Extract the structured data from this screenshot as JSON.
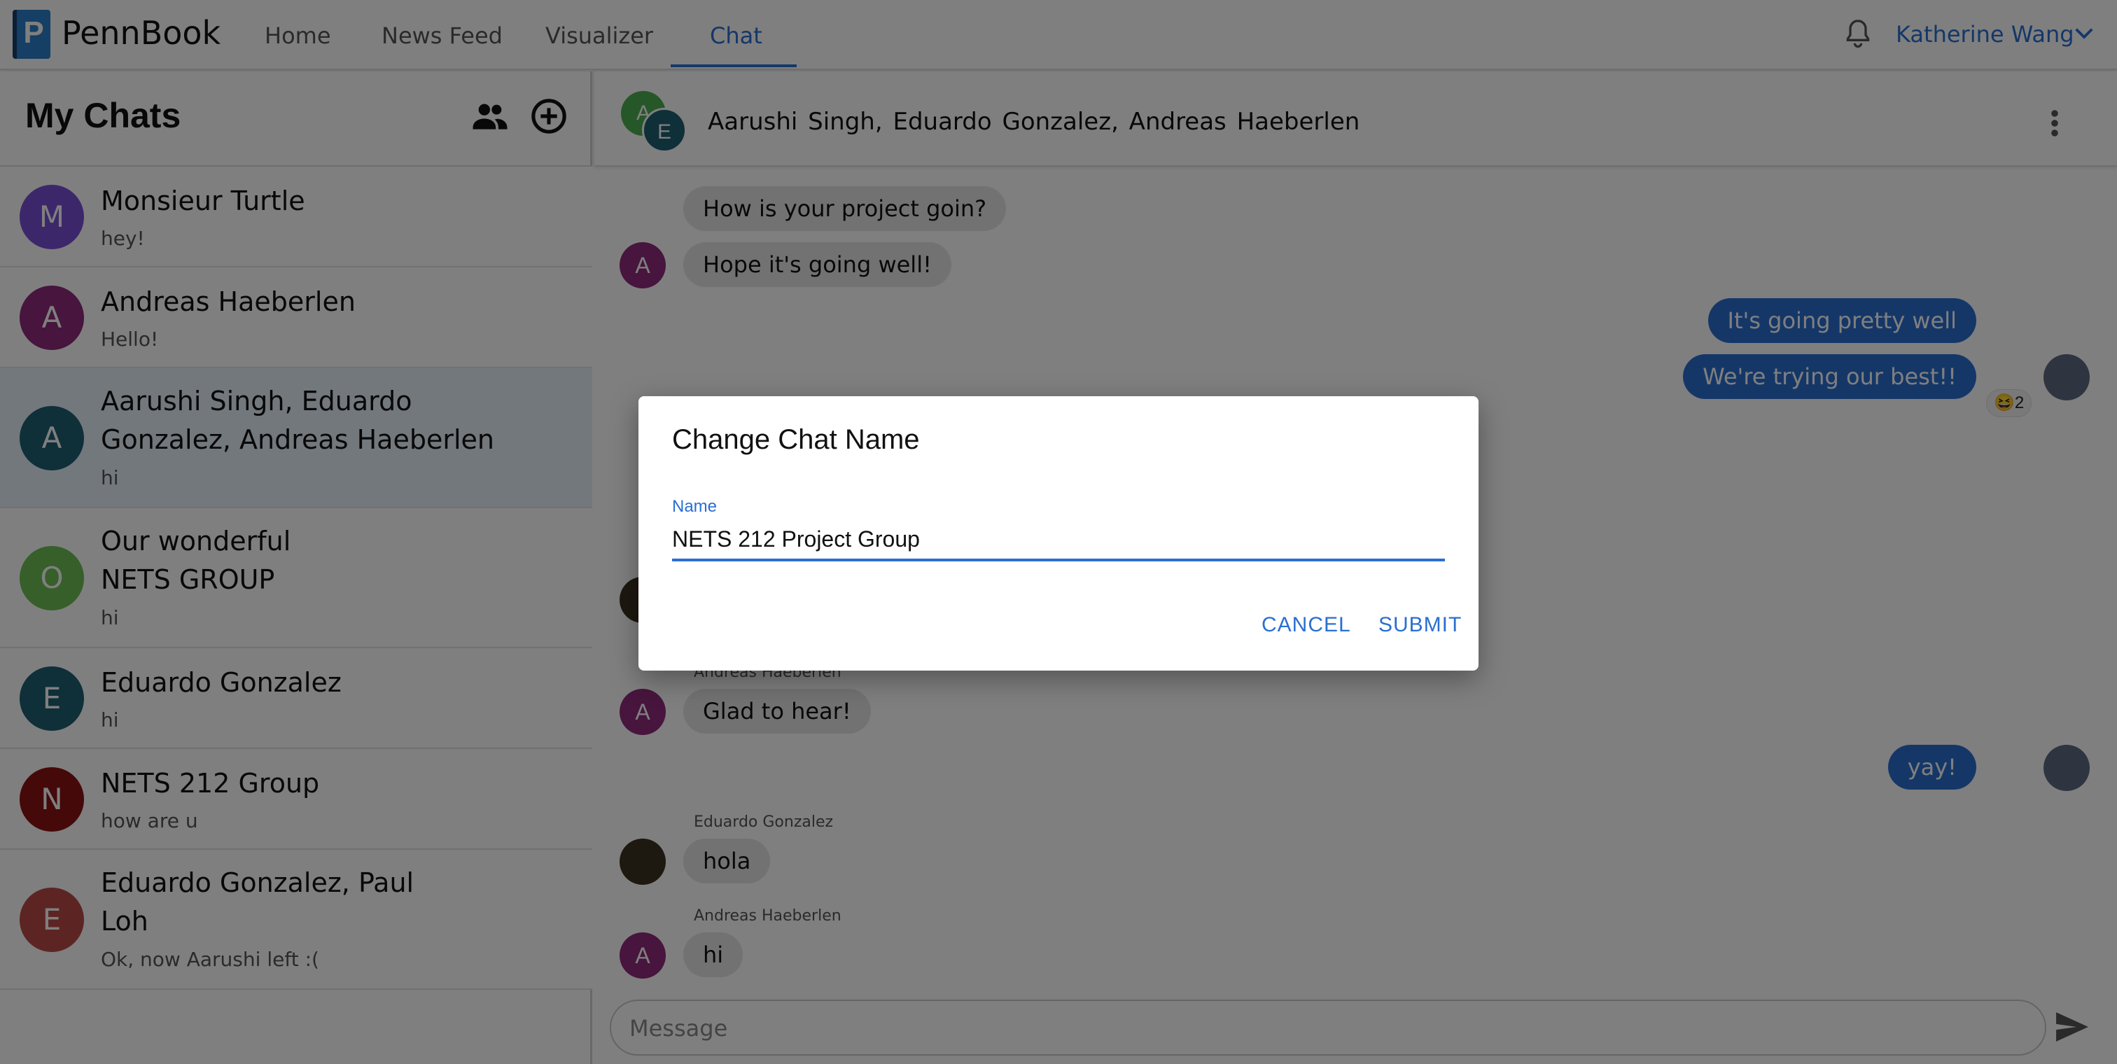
{
  "app": {
    "logo_letter": "P",
    "brand": "PennBook",
    "accent": "#2a6fd0"
  },
  "nav": {
    "items": [
      {
        "label": "Home"
      },
      {
        "label": "News Feed"
      },
      {
        "label": "Visualizer"
      },
      {
        "label": "Chat",
        "active": true
      }
    ],
    "user_name": "Katherine Wang",
    "bell_icon": "bell-icon"
  },
  "sidebar": {
    "title": "My Chats",
    "icons": [
      "people-icon",
      "add-circle-icon"
    ],
    "chats": [
      {
        "initial": "M",
        "name": "Monsieur Turtle",
        "preview": "hey!",
        "color": "#7b4fd6"
      },
      {
        "initial": "A",
        "name": "Andreas Haeberlen",
        "preview": "Hello!",
        "color": "#8e2a7a"
      },
      {
        "initial": "A",
        "name": "Aarushi Singh, Eduardo Gonzalez, Andreas Haeberlen",
        "preview": "hi",
        "color": "#1f5f73",
        "selected": true
      },
      {
        "initial": "O",
        "name": "Our wonderful NETS GROUP",
        "preview": "hi",
        "color": "#6fbf54"
      },
      {
        "initial": "E",
        "name": "Eduardo Gonzalez",
        "preview": "hi",
        "color": "#1f5f73"
      },
      {
        "initial": "N",
        "name": "NETS 212 Group",
        "preview": "how are u",
        "color": "#8b1212"
      },
      {
        "initial": "E",
        "name": "Eduardo Gonzalez, Paul Loh",
        "preview": "Ok, now Aarushi left :(",
        "color": "#b84a47"
      }
    ]
  },
  "chat": {
    "header_avatars": [
      "A",
      "E"
    ],
    "header_names": "Aarushi Singh,  Eduardo Gonzalez,  Andreas Haeberlen",
    "messages": [
      {
        "text": "How is your project goin?"
      },
      {
        "text": "Hope it's going well!",
        "avatar": "A"
      },
      {
        "text": "It's going pretty well"
      },
      {
        "text": "We're trying our best!!",
        "reaction": "😆2"
      },
      {
        "sender": "Andreas Haeberlen",
        "text": "Glad to hear!",
        "avatar": "A"
      },
      {
        "text": "yay!"
      },
      {
        "sender": "Eduardo Gonzalez",
        "text": "hola"
      },
      {
        "sender": "Andreas Haeberlen",
        "text": "hi",
        "avatar": "A"
      }
    ],
    "composer_placeholder": "Message"
  },
  "dialog": {
    "title": "Change Chat Name",
    "field_label": "Name",
    "field_value": "NETS 212 Project Group",
    "cancel_label": "CANCEL",
    "submit_label": "SUBMIT"
  }
}
